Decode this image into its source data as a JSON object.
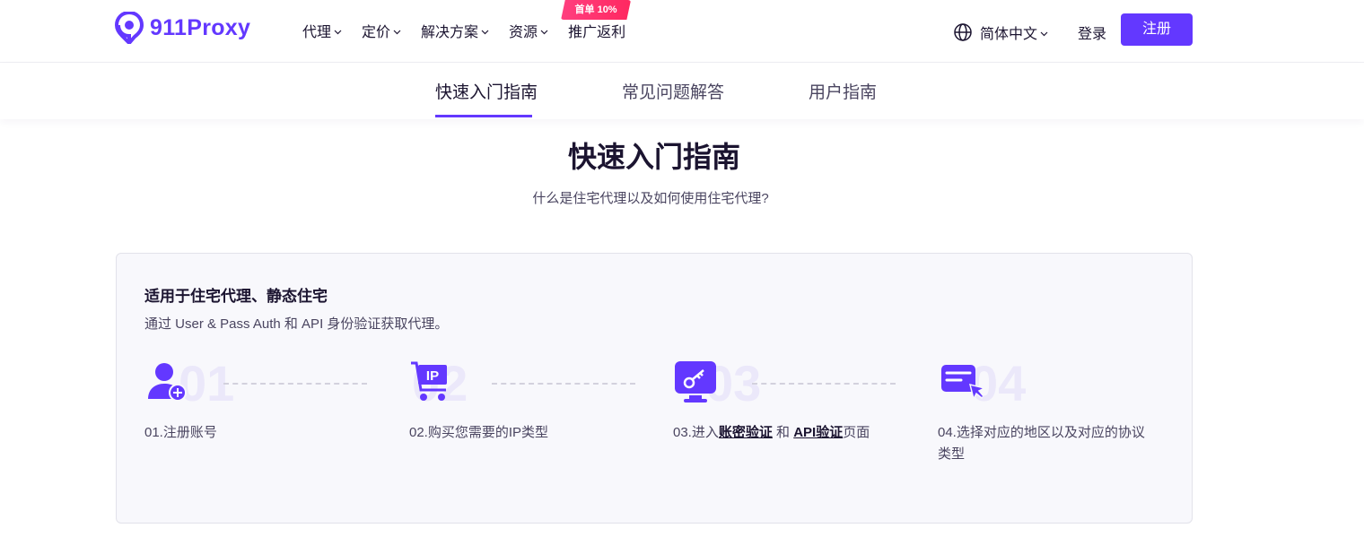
{
  "header": {
    "logo_text": "911Proxy",
    "nav": [
      {
        "label": "代理"
      },
      {
        "label": "定价"
      },
      {
        "label": "解决方案"
      },
      {
        "label": "资源"
      }
    ],
    "promo": {
      "label": "推广返利",
      "badge": "首单 10%"
    },
    "language": "简体中文",
    "login": "登录",
    "register": "注册"
  },
  "tabs": [
    {
      "label": "快速入门指南",
      "active": true
    },
    {
      "label": "常见问题解答",
      "active": false
    },
    {
      "label": "用户指南",
      "active": false
    }
  ],
  "main": {
    "title": "快速入门指南",
    "subtitle": "什么是住宅代理以及如何使用住宅代理?"
  },
  "card": {
    "title": "适用于住宅代理、静态住宅",
    "desc": "通过 User & Pass Auth 和 API 身份验证获取代理。",
    "steps": [
      {
        "num": "01",
        "icon": "user-add-icon",
        "text": "01.注册账号"
      },
      {
        "num": "02",
        "icon": "ip-cart-icon",
        "text": "02.购买您需要的IP类型"
      },
      {
        "num": "03",
        "icon": "key-monitor-icon",
        "prefix": "03.进入",
        "link1": "账密验证",
        "mid": " 和 ",
        "link2": "API验证",
        "suffix": "页面"
      },
      {
        "num": "04",
        "icon": "form-cursor-icon",
        "text_line1": "04.选择对应的地区以及对应的协议",
        "text_line2": "类型"
      }
    ]
  },
  "colors": {
    "accent": "#6338ff",
    "promo": "#ff2f6c"
  }
}
